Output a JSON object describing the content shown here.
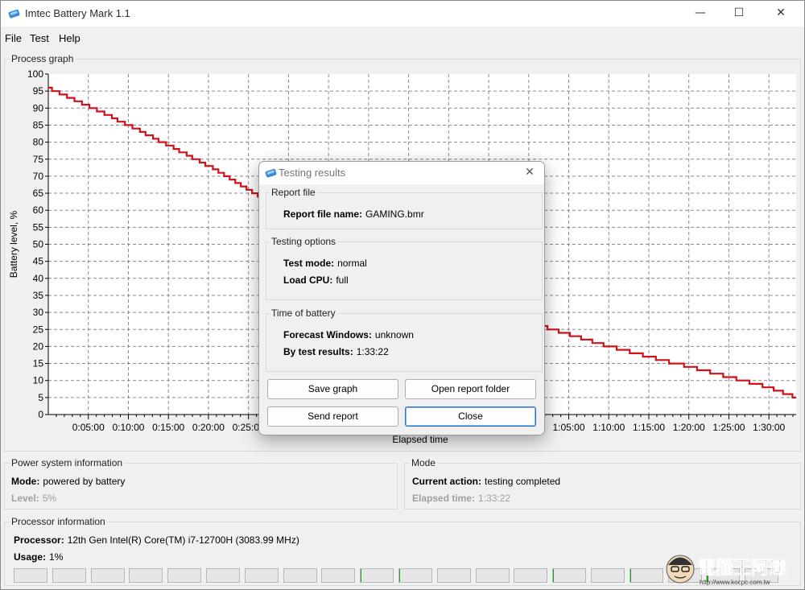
{
  "window": {
    "title": "Imtec Battery Mark 1.1",
    "min_glyph": "—",
    "max_glyph": "☐",
    "close_glyph": "✕"
  },
  "menu": [
    "File",
    "Test",
    "Help"
  ],
  "graph": {
    "group_title": "Process graph"
  },
  "chart_data": {
    "type": "line",
    "ylabel": "Battery level, %",
    "xlabel": "Elapsed time",
    "ylim": [
      0,
      100
    ],
    "y_ticks": [
      0,
      5,
      10,
      15,
      20,
      25,
      30,
      35,
      40,
      45,
      50,
      55,
      60,
      65,
      70,
      75,
      80,
      85,
      90,
      95,
      100
    ],
    "xlim_minutes": [
      0,
      93.4
    ],
    "x_ticks": [
      "0:05:00",
      "0:10:00",
      "0:15:00",
      "0:20:00",
      "0:25:00",
      "0:30:00",
      "0:35:00",
      "0:40:00",
      "0:45:00",
      "0:50:00",
      "0:55:00",
      "1:00:00",
      "1:05:00",
      "1:10:00",
      "1:15:00",
      "1:20:00",
      "1:25:00",
      "1:30:00"
    ],
    "grid": true,
    "series": [
      {
        "color": "#d0121b",
        "x_minutes": [
          0,
          10,
          20,
          30,
          40,
          50,
          60,
          70,
          80,
          90,
          93.4
        ],
        "y": [
          96,
          85,
          73,
          59,
          47,
          36,
          27,
          20,
          14,
          8,
          5
        ]
      }
    ]
  },
  "power": {
    "group_title": "Power system information",
    "mode_label": "Mode:",
    "mode_value": "powered by battery",
    "level_label": "Level:",
    "level_value": "5%"
  },
  "mode": {
    "group_title": "Mode",
    "action_label": "Current action:",
    "action_value": "testing completed",
    "elapsed_label": "Elapsed time:",
    "elapsed_value": "1:33:22"
  },
  "processor": {
    "group_title": "Processor information",
    "name_label": "Processor:",
    "name_value": "12th Gen Intel(R) Core(TM) i7-12700H  (3083.99 MHz)",
    "usage_label": "Usage:",
    "usage_value": "1%",
    "core_loads": [
      0,
      0,
      0,
      0,
      0,
      0,
      0,
      0,
      0,
      0.03,
      0.02,
      0,
      0,
      0,
      0.02,
      0,
      0.04,
      0,
      0.03,
      0
    ]
  },
  "dialog": {
    "title": "Testing results",
    "close_glyph": "✕",
    "report_group": "Report file",
    "report_name_label": "Report file name:",
    "report_name_value": "GAMING.bmr",
    "options_group": "Testing options",
    "test_mode_label": "Test mode:",
    "test_mode_value": "normal",
    "load_cpu_label": "Load CPU:",
    "load_cpu_value": "full",
    "time_group": "Time of battery",
    "forecast_label": "Forecast Windows:",
    "forecast_value": "unknown",
    "by_test_label": "By test results:",
    "by_test_value": "1:33:22",
    "save_graph": "Save graph",
    "open_folder": "Open report folder",
    "send_report": "Send report",
    "close": "Close"
  },
  "watermark": {
    "brand": "電腦王阿達",
    "url": "http://www.kocpc.com.tw"
  },
  "colors": {
    "battery_line": "#d0121b",
    "core_fill": "#19a519",
    "primary_border": "#2f6fc4"
  }
}
